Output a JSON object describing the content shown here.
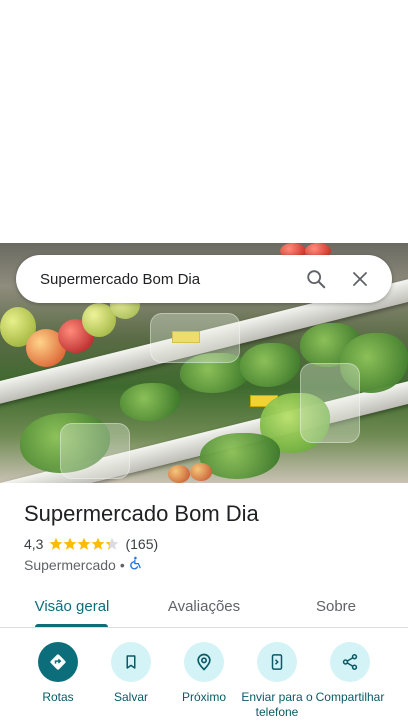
{
  "search": {
    "query": "Supermercado Bom Dia"
  },
  "place": {
    "name": "Supermercado Bom Dia",
    "rating": "4,3",
    "stars": 4.3,
    "review_count": "(165)",
    "category": "Supermercado",
    "separator": "•"
  },
  "tabs": [
    {
      "label": "Visão geral",
      "active": true
    },
    {
      "label": "Avaliações",
      "active": false
    },
    {
      "label": "Sobre",
      "active": false
    }
  ],
  "actions": [
    {
      "label": "Rotas",
      "icon": "directions-icon"
    },
    {
      "label": "Salvar",
      "icon": "bookmark-icon"
    },
    {
      "label": "Próximo",
      "icon": "nearby-icon"
    },
    {
      "label": "Enviar para o telefone",
      "icon": "send-to-phone-icon"
    },
    {
      "label": "Compartilhar",
      "icon": "share-icon"
    }
  ],
  "colors": {
    "accent": "#0b6e7a",
    "action_bg": "#d3f3f6",
    "star": "#fbbc04",
    "accessible": "#1a73e8"
  }
}
